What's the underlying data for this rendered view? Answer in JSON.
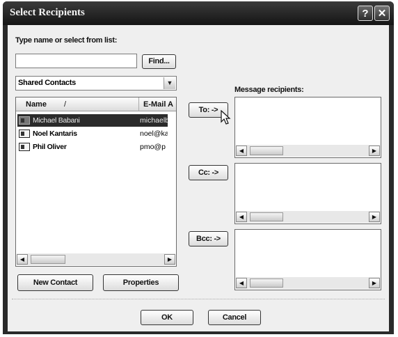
{
  "dialog": {
    "title": "Select Recipients",
    "help_glyph": "?",
    "close_glyph": "✕"
  },
  "search": {
    "label": "Type name or select from list:",
    "value": "",
    "find_label": "Find..."
  },
  "address_book": {
    "selected": "Shared Contacts"
  },
  "contacts": {
    "columns": [
      "Name",
      "E-Mail A"
    ],
    "sort_glyph": "/",
    "rows": [
      {
        "name": "Michael Babani",
        "email": "michaelb",
        "selected": true
      },
      {
        "name": "Noel Kantaris",
        "email": "noel@ka",
        "selected": false
      },
      {
        "name": "Phil Oliver",
        "email": "pmo@p",
        "selected": false
      }
    ]
  },
  "recipients": {
    "label": "Message recipients:",
    "to_label": "To: ->",
    "cc_label": "Cc: ->",
    "bcc_label": "Bcc: ->"
  },
  "actions": {
    "new_contact": "New Contact",
    "properties": "Properties",
    "ok": "OK",
    "cancel": "Cancel"
  }
}
